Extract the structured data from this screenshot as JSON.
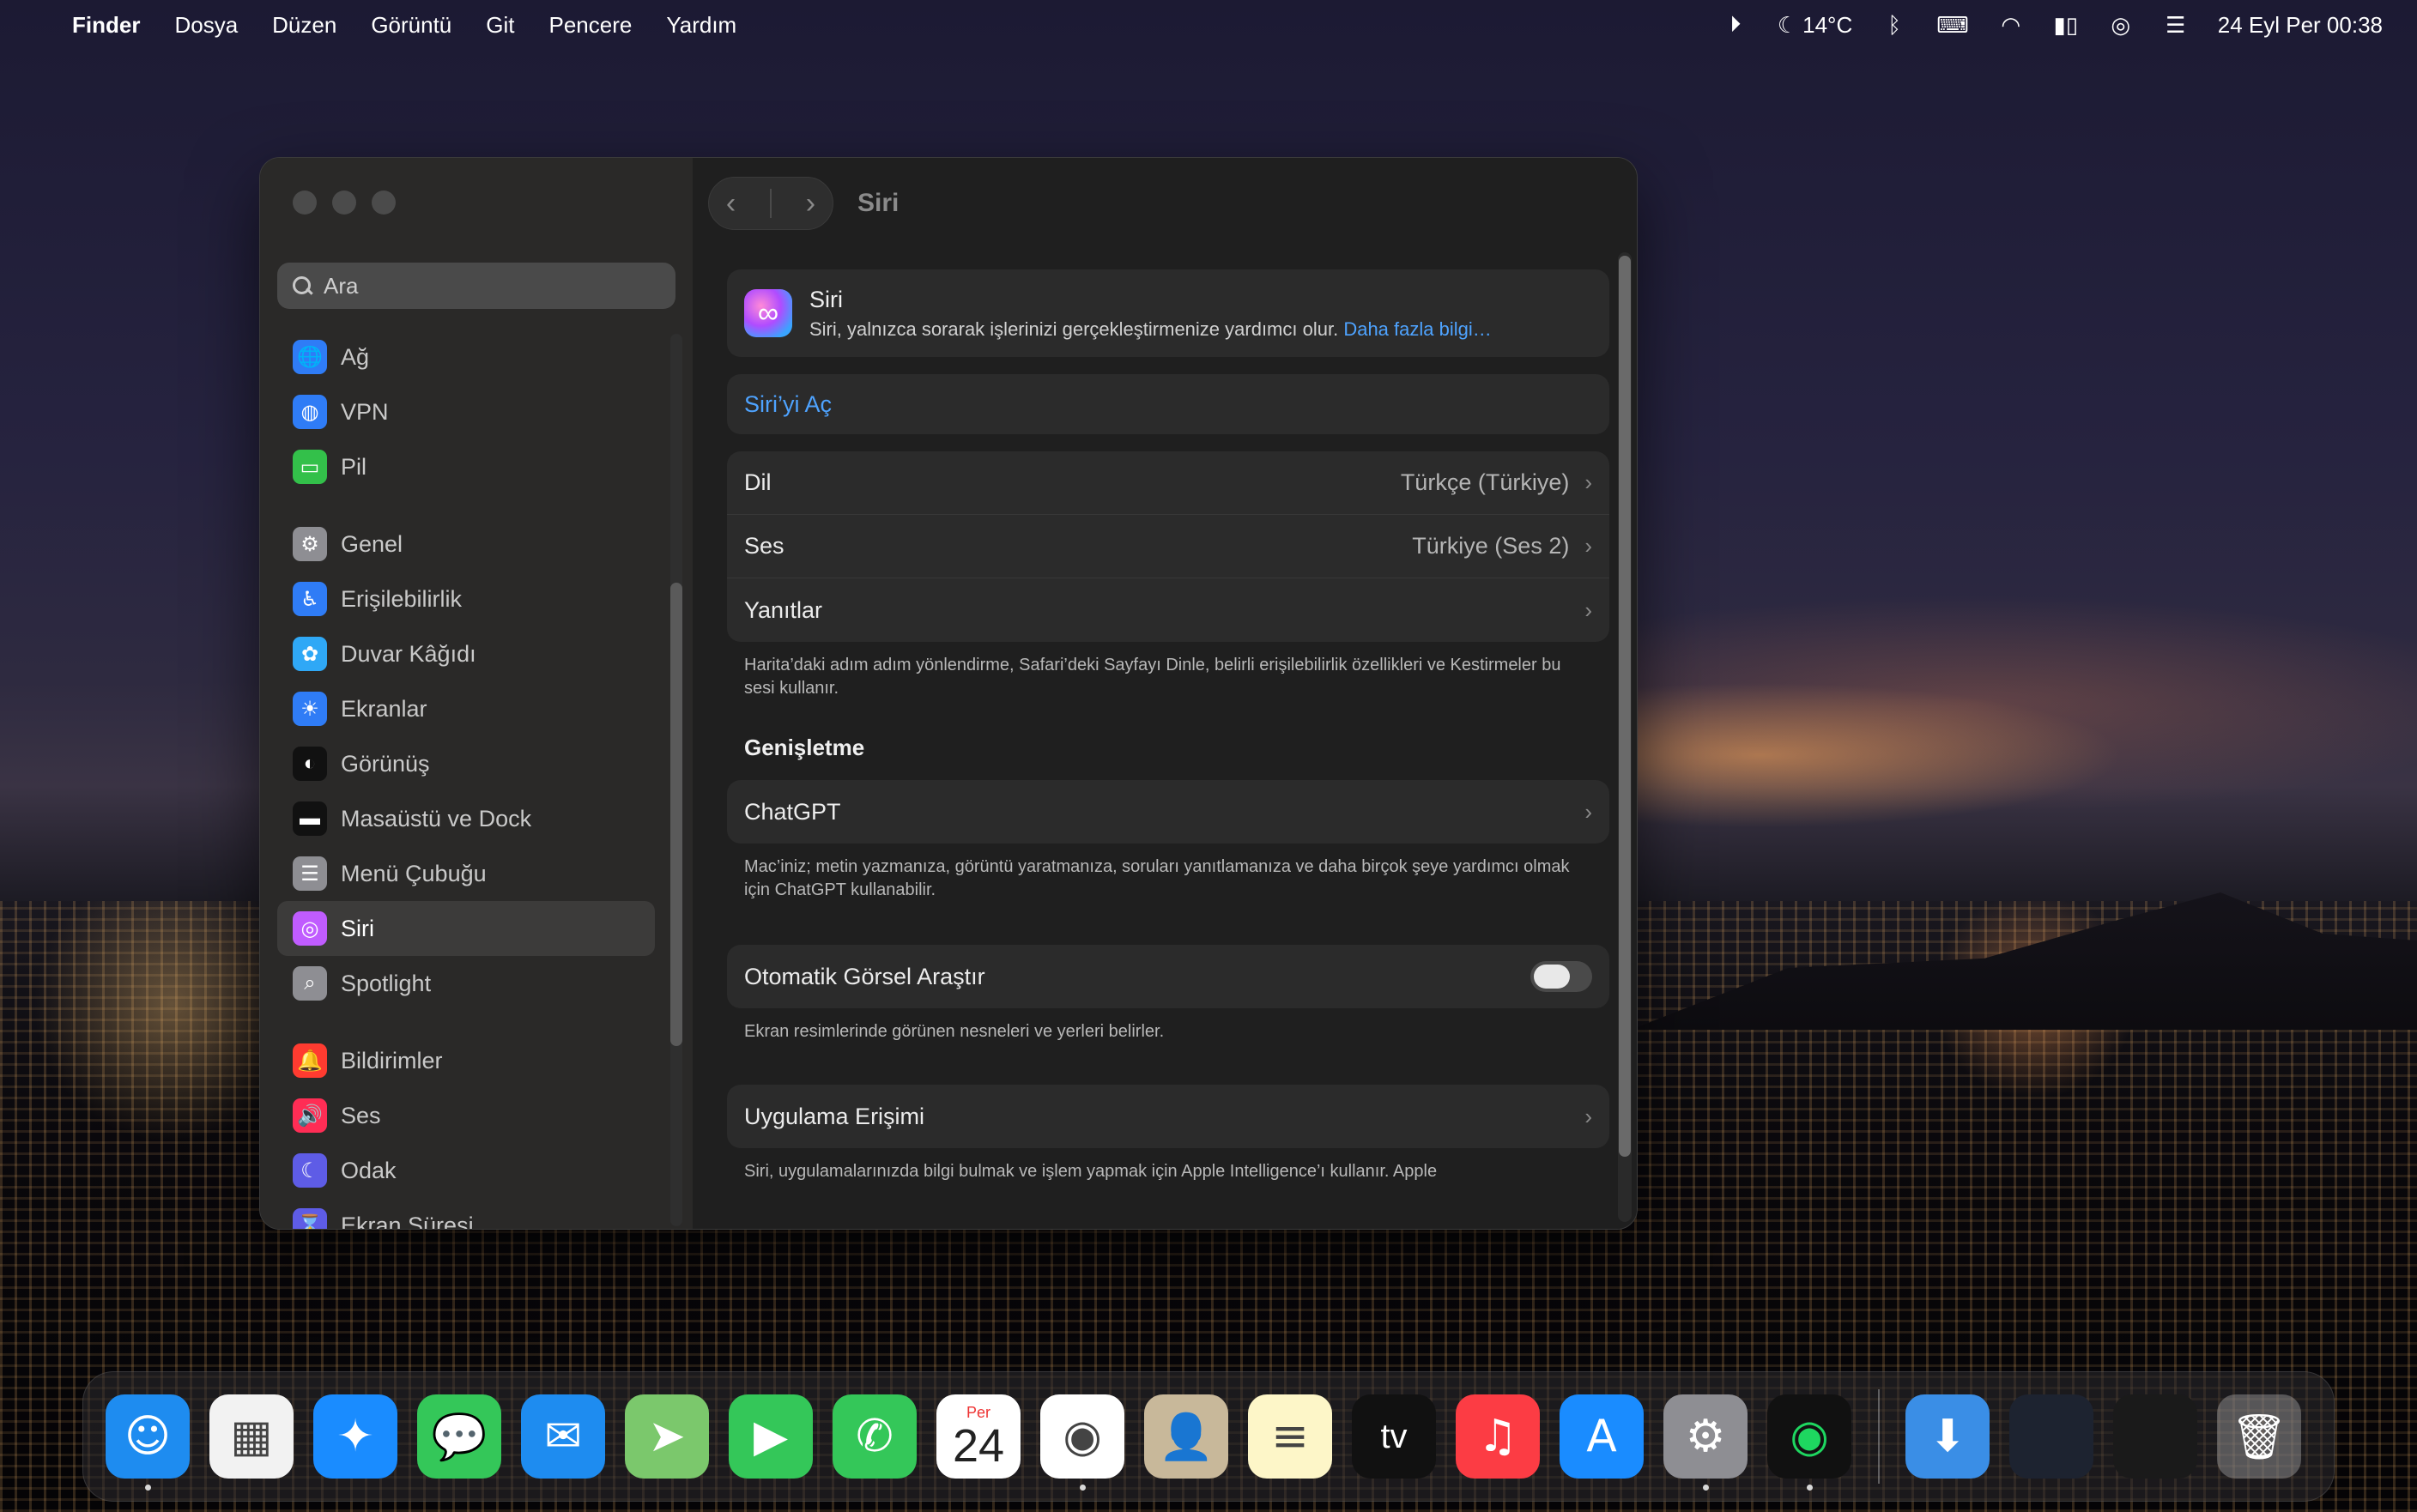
{
  "menubar": {
    "apple": "",
    "items": [
      "Finder",
      "Dosya",
      "Düzen",
      "Görüntü",
      "Git",
      "Pencere",
      "Yardım"
    ],
    "weather": "14°C",
    "datetime": "24 Eyl Per  00:38"
  },
  "window": {
    "title": "Siri",
    "search_placeholder": "Ara",
    "sidebar": [
      {
        "label": "Ağ",
        "icon": "globe-icon",
        "color": "#2f7cf6",
        "glyph": "🌐"
      },
      {
        "label": "VPN",
        "icon": "vpn-globe-icon",
        "color": "#2f7cf6",
        "glyph": "◍"
      },
      {
        "label": "Pil",
        "icon": "battery-icon",
        "color": "#33c04a",
        "glyph": "▭"
      },
      {
        "label": "Genel",
        "icon": "gear-icon",
        "color": "#8e8e93",
        "glyph": "⚙"
      },
      {
        "label": "Erişilebilirlik",
        "icon": "accessibility-icon",
        "color": "#2f7cf6",
        "glyph": "♿"
      },
      {
        "label": "Duvar Kâğıdı",
        "icon": "wallpaper-icon",
        "color": "#2fa8f6",
        "glyph": "✿"
      },
      {
        "label": "Ekranlar",
        "icon": "sun-icon",
        "color": "#2f7cf6",
        "glyph": "☀"
      },
      {
        "label": "Görünüş",
        "icon": "appearance-icon",
        "color": "#111111",
        "glyph": "◐"
      },
      {
        "label": "Masaüstü ve Dock",
        "icon": "dock-icon",
        "color": "#111111",
        "glyph": "▬"
      },
      {
        "label": "Menü Çubuğu",
        "icon": "menubar-icon",
        "color": "#8e8e93",
        "glyph": "☰"
      },
      {
        "label": "Siri",
        "icon": "siri-icon",
        "color": "#c05cff",
        "glyph": "◎"
      },
      {
        "label": "Spotlight",
        "icon": "magnifier-icon",
        "color": "#8e8e93",
        "glyph": "⌕"
      },
      {
        "label": "Bildirimler",
        "icon": "bell-icon",
        "color": "#ff3b30",
        "glyph": "🔔"
      },
      {
        "label": "Ses",
        "icon": "speaker-icon",
        "color": "#ff2d55",
        "glyph": "🔊"
      },
      {
        "label": "Odak",
        "icon": "moon-icon",
        "color": "#5e5ce6",
        "glyph": "☾"
      },
      {
        "label": "Ekran Süresi",
        "icon": "hourglass-icon",
        "color": "#5e5ce6",
        "glyph": "⌛"
      }
    ],
    "siri": {
      "name": "Siri",
      "desc": "Siri, yalnızca sorarak işlerinizi gerçekleştirmenize yardımcı olur.",
      "link": "Daha fazla bilgi…"
    },
    "enable_label": "Siri’yi Aç",
    "rows": {
      "language_label": "Dil",
      "language_value": "Türkçe (Türkiye)",
      "voice_label": "Ses",
      "voice_value": "Türkiye (Ses 2)",
      "responses_label": "Yanıtlar"
    },
    "voice_note": "Harita’daki adım adım yönlendirme, Safari’deki Sayfayı Dinle, belirli erişilebilirlik özellikleri ve Kestirmeler bu sesi kullanır.",
    "extension_header": "Genişletme",
    "chatgpt_label": "ChatGPT",
    "chatgpt_note": "Mac’iniz; metin yazmanıza, görüntü yaratmanıza, soruları yanıtlamanıza ve daha birçok şeye yardımcı olmak için ChatGPT kullanabilir.",
    "visual_label": "Otomatik Görsel Araştır",
    "visual_enabled": false,
    "visual_note": "Ekran resimlerinde görünen nesneleri ve yerleri belirler.",
    "app_access_label": "Uygulama Erişimi",
    "app_access_note": "Siri, uygulamalarınızda bilgi bulmak ve işlem yapmak için Apple Intelligence’ı kullanır. Apple"
  },
  "dock": {
    "calendar_month": "Per",
    "calendar_day": "24",
    "tv_label": "tv",
    "apps": [
      {
        "name": "finder-icon",
        "bg": "#1e8cf0",
        "glyph": "☺",
        "running": true
      },
      {
        "name": "launchpad-icon",
        "bg": "#f2f2f2",
        "glyph": "▦",
        "running": false
      },
      {
        "name": "safari-icon",
        "bg": "#1a8cff",
        "glyph": "✦",
        "running": false
      },
      {
        "name": "messages-icon",
        "bg": "#34c759",
        "glyph": "💬",
        "running": false
      },
      {
        "name": "mail-icon",
        "bg": "#1e8cf0",
        "glyph": "✉",
        "running": false
      },
      {
        "name": "maps-icon",
        "bg": "#7bc86c",
        "glyph": "➤",
        "running": false
      },
      {
        "name": "facetime-icon",
        "bg": "#34c759",
        "glyph": "▶",
        "running": false
      },
      {
        "name": "phone-icon",
        "bg": "#34c759",
        "glyph": "✆",
        "running": false
      },
      {
        "name": "calendar-icon",
        "bg": "#ffffff",
        "glyph": "",
        "running": false
      },
      {
        "name": "chrome-icon",
        "bg": "#ffffff",
        "glyph": "◉",
        "running": true
      },
      {
        "name": "contacts-icon",
        "bg": "#c8b89a",
        "glyph": "👤",
        "running": false
      },
      {
        "name": "notes-icon",
        "bg": "#fdf6c8",
        "glyph": "≡",
        "running": false
      },
      {
        "name": "appletv-icon",
        "bg": "#111111",
        "glyph": "",
        "running": false
      },
      {
        "name": "music-icon",
        "bg": "#fc3c44",
        "glyph": "♫",
        "running": false
      },
      {
        "name": "appstore-icon",
        "bg": "#1a8cff",
        "glyph": "A",
        "running": false
      },
      {
        "name": "system-settings-icon",
        "bg": "#8e8e93",
        "glyph": "⚙",
        "running": true
      },
      {
        "name": "spotify-icon",
        "bg": "#111111",
        "glyph": "◉",
        "running": true
      }
    ],
    "right": [
      {
        "name": "downloads-folder-icon",
        "bg": "#3a8ee6",
        "glyph": "⬇"
      },
      {
        "name": "chrome-window-thumbnail",
        "bg": "#1d2330",
        "glyph": ""
      },
      {
        "name": "spotify-window-thumbnail",
        "bg": "#1a1a1a",
        "glyph": ""
      },
      {
        "name": "trash-icon",
        "bg": "rgba(200,200,200,0.35)",
        "glyph": "🗑"
      }
    ]
  }
}
